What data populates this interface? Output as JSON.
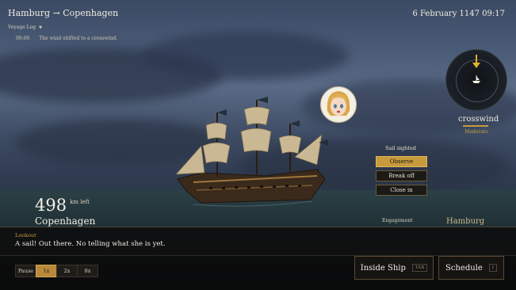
{
  "header": {
    "route": "Hamburg → Copenhagen",
    "voyage_log_label": "Voyage Log",
    "log_entries": [
      {
        "time": "06:00",
        "text": "The wind shifted to a crosswind."
      }
    ]
  },
  "datetime": "6 February 1147  09:17",
  "wind": {
    "label": "crosswind",
    "strength": "Moderate",
    "icon": "wind-arrow-icon"
  },
  "encounter": {
    "title": "Sail sighted",
    "options": [
      {
        "label": "Observe",
        "selected": true
      },
      {
        "label": "Break off",
        "selected": false
      },
      {
        "label": "Close in",
        "selected": false
      }
    ]
  },
  "voyage": {
    "distance": "498",
    "distance_unit": "km left",
    "destination": "Copenhagen",
    "engagement_label": "Engagement",
    "origin": "Hamburg"
  },
  "dialog": {
    "speaker": "Lookout",
    "line": "A sail! Out there. No telling what she is yet."
  },
  "controls": {
    "speed": [
      {
        "label": "Pause",
        "active": false
      },
      {
        "label": "1x",
        "active": true
      },
      {
        "label": "2x",
        "active": false
      },
      {
        "label": "8x",
        "active": false
      }
    ],
    "inside_ship": {
      "label": "Inside Ship",
      "key": "TAB"
    },
    "schedule": {
      "label": "Schedule",
      "key": "I"
    }
  },
  "colors": {
    "accent": "#c79a3c",
    "sky": "#4b5c78",
    "panel": "#151412"
  }
}
